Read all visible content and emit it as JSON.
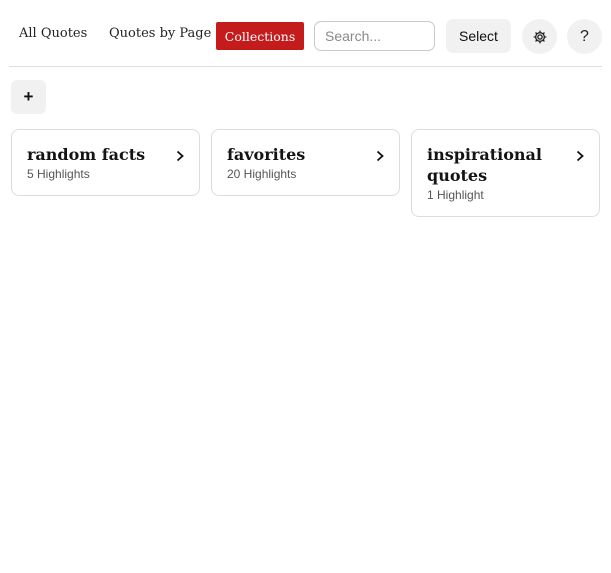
{
  "nav": {
    "all_quotes": "All Quotes",
    "quotes_by_page": "Quotes by Page",
    "collections": "Collections"
  },
  "search": {
    "placeholder": "Search..."
  },
  "toolbar": {
    "select_label": "Select",
    "gear_icon": "gear-icon",
    "help_label": "?"
  },
  "add_button": {
    "label": "+"
  },
  "collections": [
    {
      "title": "random facts",
      "count": "5 Highlights"
    },
    {
      "title": "favorites",
      "count": "20 Highlights"
    },
    {
      "title": "inspirational quotes",
      "count": "1 Highlight"
    }
  ],
  "colors": {
    "accent": "#c41c1c",
    "button_bg": "#f1f1f1",
    "border": "#dcdcdc"
  }
}
